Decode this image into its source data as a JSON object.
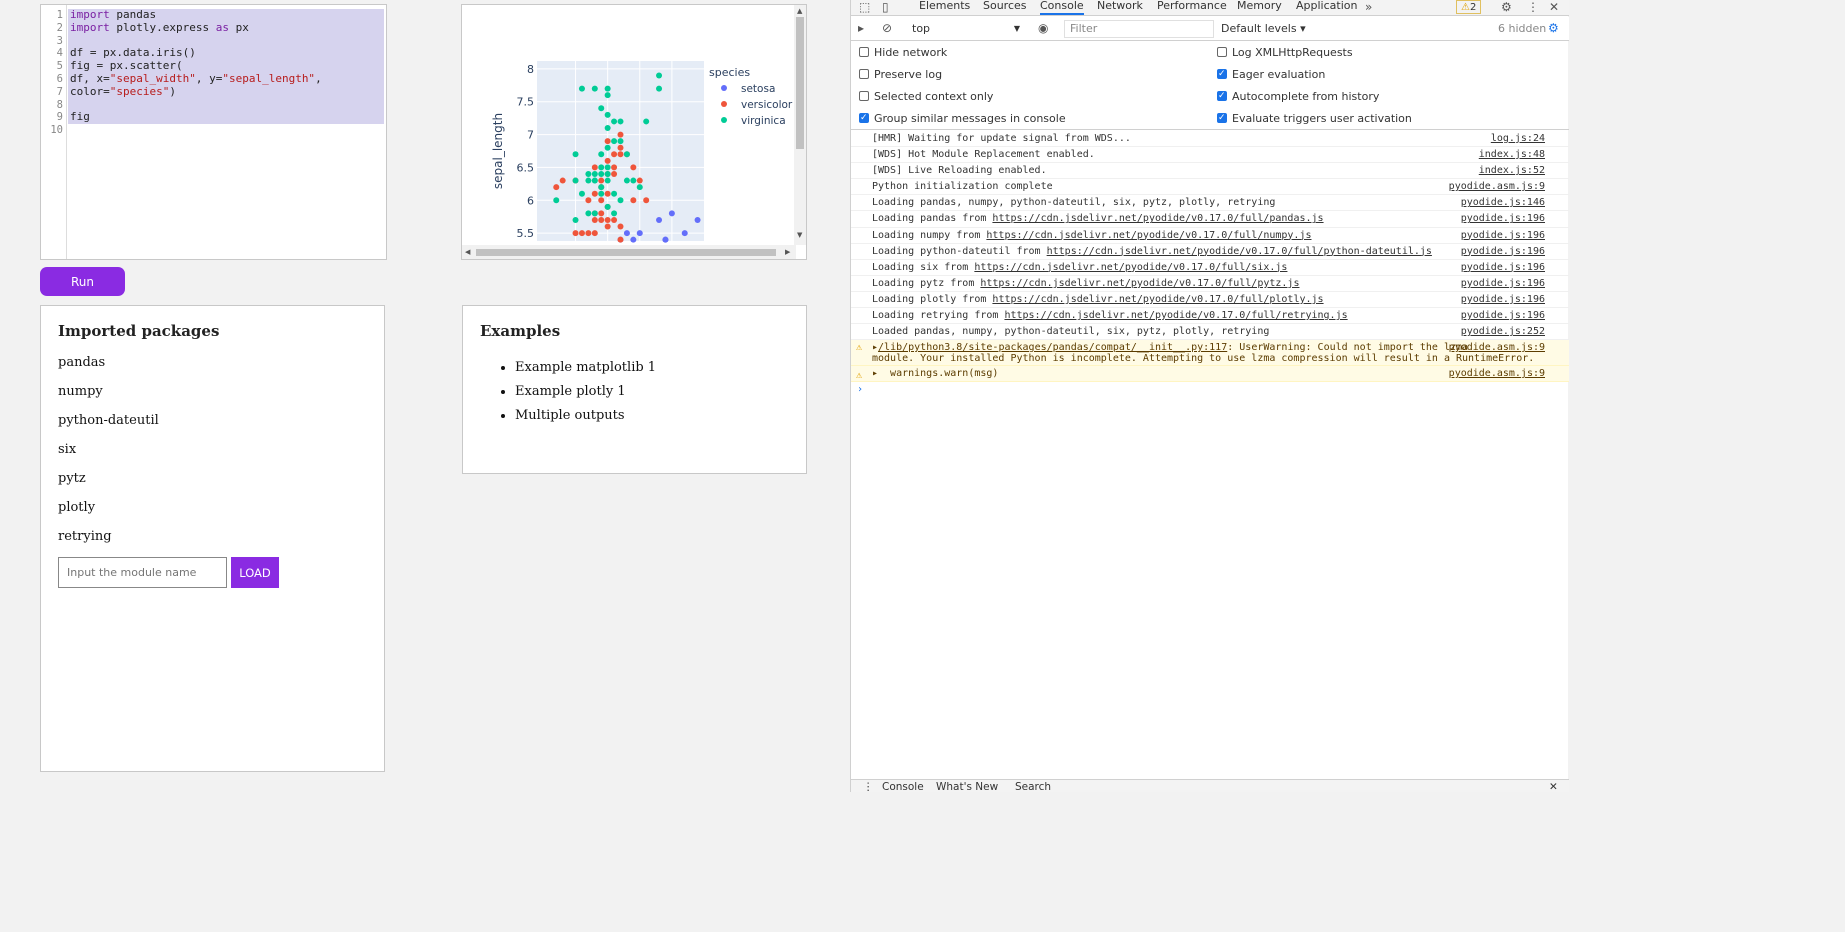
{
  "editor": {
    "line_numbers": [
      "1",
      "2",
      "3",
      "4",
      "5",
      "6",
      "7",
      "8",
      "9",
      "10"
    ]
  },
  "run_label": "Run",
  "chart_data": {
    "type": "scatter",
    "legend_title": "species",
    "ylabel": "sepal_length",
    "xlabel": "",
    "ylim": [
      5.38,
      8.12
    ],
    "xlim": [
      1.9,
      4.5
    ],
    "y_ticks": [
      "5.5",
      "6",
      "6.5",
      "7",
      "7.5",
      "8"
    ],
    "series": [
      {
        "name": "setosa",
        "color": "#636efa",
        "points": [
          [
            4.4,
            5.7
          ],
          [
            4.1,
            5.2
          ],
          [
            4.2,
            5.5
          ],
          [
            3.9,
            5.4
          ],
          [
            4.0,
            5.8
          ],
          [
            3.9,
            5.4
          ],
          [
            3.8,
            5.7
          ],
          [
            3.5,
            5.5
          ],
          [
            3.4,
            5.4
          ],
          [
            3.2,
            5.4
          ],
          [
            3.3,
            5.5
          ],
          [
            3.7,
            5.3
          ]
        ]
      },
      {
        "name": "versicolor",
        "color": "#ef553b",
        "points": [
          [
            2.2,
            6.2
          ],
          [
            2.3,
            6.3
          ],
          [
            2.5,
            5.5
          ],
          [
            2.6,
            5.5
          ],
          [
            2.7,
            5.5
          ],
          [
            2.8,
            5.5
          ],
          [
            2.8,
            5.7
          ],
          [
            2.8,
            5.8
          ],
          [
            2.9,
            5.7
          ],
          [
            3.0,
            5.7
          ],
          [
            2.9,
            5.8
          ],
          [
            3.0,
            5.6
          ],
          [
            3.0,
            5.9
          ],
          [
            3.1,
            5.7
          ],
          [
            3.2,
            5.6
          ],
          [
            3.2,
            5.4
          ],
          [
            2.5,
            6.3
          ],
          [
            2.7,
            6.0
          ],
          [
            2.8,
            6.1
          ],
          [
            2.9,
            6.0
          ],
          [
            2.9,
            6.2
          ],
          [
            3.0,
            6.1
          ],
          [
            3.0,
            6.4
          ],
          [
            3.0,
            6.6
          ],
          [
            3.1,
            6.5
          ],
          [
            3.1,
            6.7
          ],
          [
            3.0,
            6.9
          ],
          [
            3.2,
            6.7
          ],
          [
            3.2,
            7.0
          ],
          [
            3.4,
            6.0
          ],
          [
            3.5,
            6.3
          ],
          [
            3.3,
            6.7
          ],
          [
            2.9,
            6.3
          ],
          [
            3.1,
            6.4
          ],
          [
            2.8,
            6.5
          ],
          [
            3.4,
            6.5
          ],
          [
            3.6,
            6.0
          ],
          [
            3.2,
            6.8
          ]
        ]
      },
      {
        "name": "virginica",
        "color": "#00cc96",
        "points": [
          [
            2.2,
            6.0
          ],
          [
            2.5,
            6.7
          ],
          [
            2.6,
            7.7
          ],
          [
            2.8,
            7.7
          ],
          [
            3.0,
            7.7
          ],
          [
            3.0,
            7.6
          ],
          [
            2.9,
            7.4
          ],
          [
            3.0,
            7.3
          ],
          [
            3.1,
            7.2
          ],
          [
            3.2,
            7.2
          ],
          [
            3.0,
            7.1
          ],
          [
            3.1,
            6.9
          ],
          [
            3.2,
            6.9
          ],
          [
            3.3,
            6.7
          ],
          [
            3.0,
            6.8
          ],
          [
            3.0,
            6.5
          ],
          [
            2.8,
            6.4
          ],
          [
            2.9,
            6.4
          ],
          [
            3.0,
            6.3
          ],
          [
            3.1,
            6.1
          ],
          [
            3.2,
            6.0
          ],
          [
            2.7,
            6.3
          ],
          [
            2.8,
            6.3
          ],
          [
            2.9,
            6.1
          ],
          [
            2.9,
            6.2
          ],
          [
            2.7,
            5.8
          ],
          [
            2.8,
            5.8
          ],
          [
            2.5,
            5.7
          ],
          [
            2.6,
            6.1
          ],
          [
            2.5,
            6.3
          ],
          [
            2.9,
            6.5
          ],
          [
            3.4,
            6.3
          ],
          [
            3.5,
            6.2
          ],
          [
            3.6,
            7.2
          ],
          [
            3.8,
            7.7
          ],
          [
            3.8,
            7.9
          ],
          [
            3.3,
            6.3
          ],
          [
            3.0,
            6.4
          ],
          [
            2.8,
            6.3
          ],
          [
            3.0,
            5.9
          ],
          [
            3.1,
            5.8
          ],
          [
            2.7,
            6.4
          ],
          [
            2.9,
            6.7
          ]
        ]
      }
    ]
  },
  "packages": {
    "title": "Imported packages",
    "items": [
      "pandas",
      "numpy",
      "python-dateutil",
      "six",
      "pytz",
      "plotly",
      "retrying"
    ],
    "input_placeholder": "Input the module name",
    "load_label": "LOAD"
  },
  "examples": {
    "title": "Examples",
    "items": [
      "Example matplotlib 1",
      "Example plotly 1",
      "Multiple outputs"
    ]
  },
  "devtools": {
    "tabs": [
      "Elements",
      "Sources",
      "Console",
      "Network",
      "Performance",
      "Memory",
      "Application"
    ],
    "active_tab": "Console",
    "warning_count": "2",
    "context": "top",
    "filter_placeholder": "Filter",
    "levels": "Default levels ▾",
    "hidden": "6 hidden",
    "options_left": [
      {
        "label": "Hide network",
        "checked": false
      },
      {
        "label": "Preserve log",
        "checked": false
      },
      {
        "label": "Selected context only",
        "checked": false
      },
      {
        "label": "Group similar messages in console",
        "checked": true
      }
    ],
    "options_right": [
      {
        "label": "Log XMLHttpRequests",
        "checked": false
      },
      {
        "label": "Eager evaluation",
        "checked": true
      },
      {
        "label": "Autocomplete from history",
        "checked": true
      },
      {
        "label": "Evaluate triggers user activation",
        "checked": true
      }
    ],
    "messages": [
      {
        "text": "[HMR] Waiting for update signal from WDS...",
        "src": "log.js:24"
      },
      {
        "text": "[WDS] Hot Module Replacement enabled.",
        "src": "index.js:48"
      },
      {
        "text": "[WDS] Live Reloading enabled.",
        "src": "index.js:52"
      },
      {
        "text": "Python initialization complete",
        "src": "pyodide.asm.js:9"
      },
      {
        "text": "Loading pandas, numpy, python-dateutil, six, pytz, plotly, retrying",
        "src": "pyodide.js:146"
      },
      {
        "text": "Loading pandas from ",
        "link": "https://cdn.jsdelivr.net/pyodide/v0.17.0/full/pandas.js",
        "src": "pyodide.js:196"
      },
      {
        "text": "Loading numpy from ",
        "link": "https://cdn.jsdelivr.net/pyodide/v0.17.0/full/numpy.js",
        "src": "pyodide.js:196"
      },
      {
        "text": "Loading python-dateutil from ",
        "link": "https://cdn.jsdelivr.net/pyodide/v0.17.0/full/python-dateutil.js",
        "src": "pyodide.js:196"
      },
      {
        "text": "Loading six from ",
        "link": "https://cdn.jsdelivr.net/pyodide/v0.17.0/full/six.js",
        "src": "pyodide.js:196"
      },
      {
        "text": "Loading pytz from ",
        "link": "https://cdn.jsdelivr.net/pyodide/v0.17.0/full/pytz.js",
        "src": "pyodide.js:196"
      },
      {
        "text": "Loading plotly from ",
        "link": "https://cdn.jsdelivr.net/pyodide/v0.17.0/full/plotly.js",
        "src": "pyodide.js:196"
      },
      {
        "text": "Loading retrying from ",
        "link": "https://cdn.jsdelivr.net/pyodide/v0.17.0/full/retrying.js",
        "src": "pyodide.js:196"
      },
      {
        "text": "Loaded pandas, numpy, python-dateutil, six, pytz, plotly, retrying",
        "src": "pyodide.js:252"
      }
    ],
    "warning_1": {
      "link": "/lib/python3.8/site-packages/pandas/compat/__init__.py:117",
      "text_a": ": UserWarning: Could not import the lzma",
      "text_b": "module. Your installed Python is incomplete. Attempting to use lzma compression will result in a RuntimeError.",
      "src": "pyodide.asm.js:9"
    },
    "warning_2": {
      "text": "warnings.warn(msg)",
      "src": "pyodide.asm.js:9"
    },
    "drawer_tabs": [
      "Console",
      "What's New",
      "Search"
    ]
  }
}
